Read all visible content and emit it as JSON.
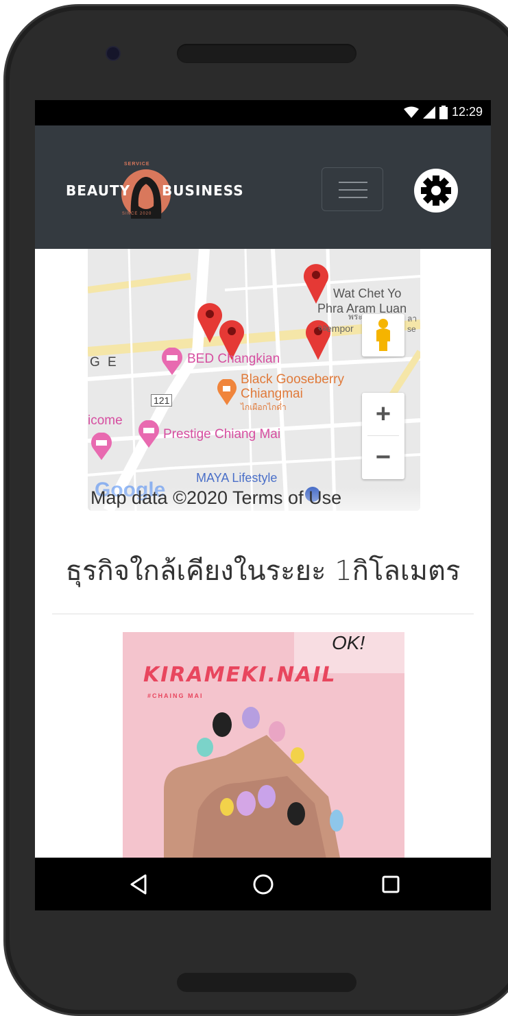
{
  "status_bar": {
    "time": "12:29",
    "icons": [
      "wifi-icon",
      "signal-icon",
      "battery-icon"
    ]
  },
  "header": {
    "logo": {
      "left_text": "BEAUTY",
      "right_text": "BUSINESS",
      "top_text": "SERVICE",
      "bottom_text": "SINCE 2020"
    },
    "menu_icon": "hamburger-icon",
    "settings_icon": "gear-icon"
  },
  "map": {
    "places": {
      "wat_chet_yo": "Wat Chet Yo",
      "phra_aram": "Phra Aram Luan",
      "bed_changkian": "BED Changkian",
      "black_gooseberry": "Black Gooseberry",
      "chiangmai": "Chiangmai",
      "chiangmai_thai": "ไกเผือกไกด่ำ",
      "prestige": "Prestige Chiang Mai",
      "maya": "MAYA Lifestyle",
      "ge": "G E",
      "icome": "icome",
      "route": "121",
      "tempor": "empor",
      "thai_a": "พระ",
      "thai_b": "จอ",
      "thai_c": "ลา",
      "se": "se"
    },
    "zoom_in": "+",
    "zoom_out": "−",
    "attribution": "Map data ©2020 Terms of Use",
    "google": "Google"
  },
  "section_heading": "ธุรกิจใกล้เคียงในระยะ 1กิโลเมตร",
  "card": {
    "sign_text": "KIRAMEKI.NAIL",
    "sub_text": "#CHAING MAI",
    "tag_text": "OK!"
  },
  "nav": {
    "back_icon": "back-triangle-icon",
    "home_icon": "home-circle-icon",
    "recents_icon": "recents-square-icon"
  }
}
